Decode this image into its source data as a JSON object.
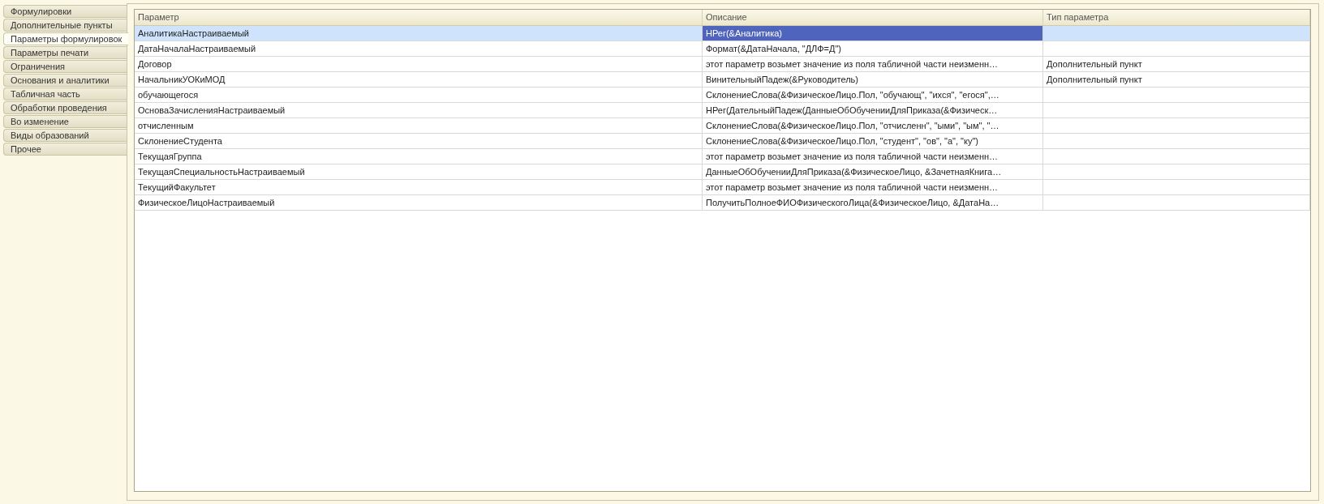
{
  "tabs": [
    {
      "label": "Формулировки",
      "selected": false
    },
    {
      "label": "Дополнительные пункты",
      "selected": false
    },
    {
      "label": "Параметры формулировок",
      "selected": true
    },
    {
      "label": "Параметры печати",
      "selected": false
    },
    {
      "label": "Ограничения",
      "selected": false
    },
    {
      "label": "Основания и аналитики",
      "selected": false
    },
    {
      "label": "Табличная часть",
      "selected": false
    },
    {
      "label": "Обработки проведения",
      "selected": false
    },
    {
      "label": "Во изменение",
      "selected": false
    },
    {
      "label": "Виды образований",
      "selected": false
    },
    {
      "label": "Прочее",
      "selected": false
    }
  ],
  "table": {
    "columns": [
      "Параметр",
      "Описание",
      "Тип параметра"
    ],
    "rows": [
      {
        "parameter": "АналитикаНастраиваемый",
        "description": "НРег(&Аналитика)",
        "type": "",
        "selected": true
      },
      {
        "parameter": "ДатаНачалаНастраиваемый",
        "description": "Формат(&ДатаНачала, \"ДЛФ=Д\")",
        "type": "",
        "selected": false
      },
      {
        "parameter": "Договор",
        "description": "этот параметр возьмет значение из поля табличной части неизменн…",
        "type": "Дополнительный пункт",
        "selected": false
      },
      {
        "parameter": "НачальникУОКиМОД",
        "description": "ВинительныйПадеж(&Руководитель)",
        "type": "Дополнительный пункт",
        "selected": false
      },
      {
        "parameter": "обучающегося",
        "description": "СклонениеСлова(&ФизическоеЛицо.Пол, \"обучающ\", \"ихся\", \"егося\",…",
        "type": "",
        "selected": false
      },
      {
        "parameter": "ОсноваЗачисленияНастраиваемый",
        "description": "НРег(ДательныйПадеж(ДанныеОбОбученииДляПриказа(&Физическ…",
        "type": "",
        "selected": false
      },
      {
        "parameter": "отчисленным",
        "description": "СклонениеСлова(&ФизическоеЛицо.Пол, \"отчисленн\", \"ыми\", \"ым\", \"…",
        "type": "",
        "selected": false
      },
      {
        "parameter": "СклонениеСтудента",
        "description": "СклонениеСлова(&ФизическоеЛицо.Пол, \"студент\", \"ов\", \"а\", \"ку\")",
        "type": "",
        "selected": false
      },
      {
        "parameter": "ТекущаяГруппа",
        "description": "этот параметр возьмет значение из поля табличной части неизменн…",
        "type": "",
        "selected": false
      },
      {
        "parameter": "ТекущаяСпециальностьНастраиваемый",
        "description": "ДанныеОбОбученииДляПриказа(&ФизическоеЛицо, &ЗачетнаяКнига…",
        "type": "",
        "selected": false
      },
      {
        "parameter": "ТекущийФакультет",
        "description": "этот параметр возьмет значение из поля табличной части неизменн…",
        "type": "",
        "selected": false
      },
      {
        "parameter": "ФизическоеЛицоНастраиваемый",
        "description": "ПолучитьПолноеФИОФизическогоЛица(&ФизическоеЛицо, &ДатаНа…",
        "type": "",
        "selected": false
      }
    ]
  }
}
